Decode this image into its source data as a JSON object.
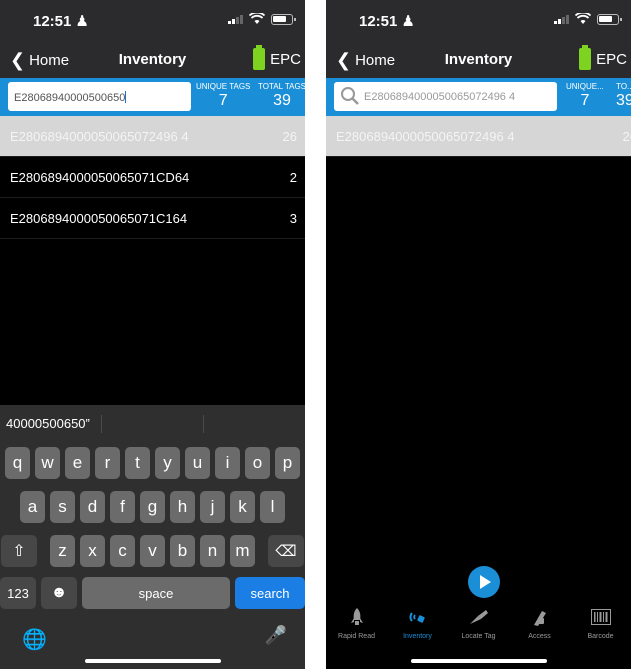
{
  "status": {
    "time": "12:51"
  },
  "nav": {
    "back_label": "Home",
    "title": "Inventory",
    "epc_label": "EPC"
  },
  "left": {
    "search_value": "E28068940000500650",
    "unique_label": "UNIQUE TAGS",
    "unique_value": "7",
    "total_label": "TOTAL TAGS",
    "total_value": "39",
    "rows": [
      {
        "epc": "E2806894000050065072496 4",
        "count": "26"
      },
      {
        "epc": "E2806894000050065071CD64",
        "count": "2"
      },
      {
        "epc": "E2806894000050065071C164",
        "count": "3"
      }
    ],
    "keyboard": {
      "suggestions": [
        "40000500650”",
        "",
        ""
      ],
      "row1": [
        "q",
        "w",
        "e",
        "r",
        "t",
        "y",
        "u",
        "i",
        "o",
        "p"
      ],
      "row2": [
        "a",
        "s",
        "d",
        "f",
        "g",
        "h",
        "j",
        "k",
        "l"
      ],
      "row3": [
        "z",
        "x",
        "c",
        "v",
        "b",
        "n",
        "m"
      ],
      "numbers_key": "123",
      "space_key": "space",
      "search_key": "search"
    }
  },
  "right": {
    "search_placeholder": "E2806894000050065072496 4",
    "unique_label": "UNIQUE...",
    "unique_value": "7",
    "total_label": "TO...",
    "total_value": "39",
    "rows": [
      {
        "epc": "E2806894000050065072496 4",
        "count": "26"
      }
    ],
    "tabs": [
      {
        "label": "Rapid Read",
        "icon": "rocket-icon"
      },
      {
        "label": "Inventory",
        "icon": "rfid-waves-icon"
      },
      {
        "label": "Locate Tag",
        "icon": "locate-icon"
      },
      {
        "label": "Access",
        "icon": "lock-icon"
      },
      {
        "label": "Barcode",
        "icon": "barcode-icon"
      }
    ]
  },
  "colors": {
    "accent": "#1a8fd8",
    "epc_battery": "#7ed321",
    "selected_row": "#d6d6d6"
  }
}
